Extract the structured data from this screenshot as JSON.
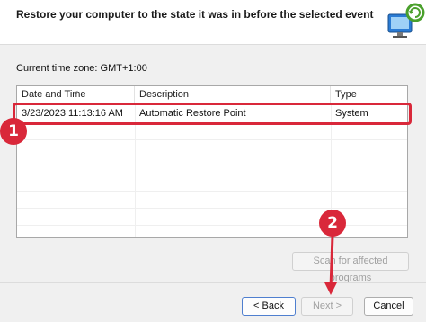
{
  "header": {
    "title": "Restore your computer to the state it was in before the selected event"
  },
  "timezone_label": "Current time zone: GMT+1:00",
  "table": {
    "columns": [
      "Date and Time",
      "Description",
      "Type"
    ],
    "rows": [
      {
        "date": "3/23/2023 11:13:16 AM",
        "description": "Automatic Restore Point",
        "type": "System"
      }
    ]
  },
  "buttons": {
    "scan": "Scan for affected programs",
    "back": "< Back",
    "next": "Next >",
    "cancel": "Cancel"
  },
  "annotations": {
    "badge1": "1",
    "badge2": "2"
  },
  "colors": {
    "accent_red": "#d9283a"
  }
}
